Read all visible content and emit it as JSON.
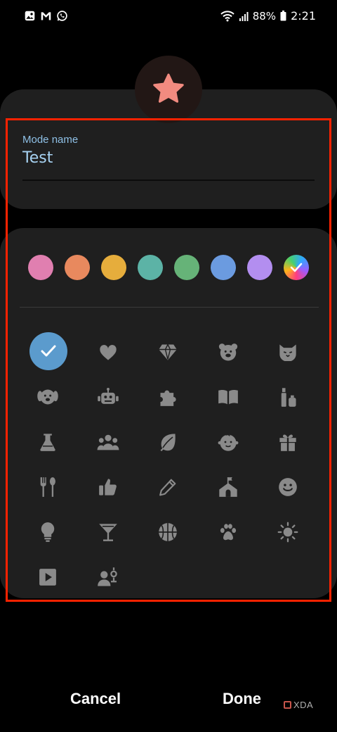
{
  "status_bar": {
    "time": "2:21",
    "battery_percent": "88%",
    "left_icons": [
      "gallery-icon",
      "gmail-icon",
      "whatsapp-icon"
    ],
    "right_icons": [
      "wifi-icon",
      "signal-icon",
      "battery-icon"
    ]
  },
  "mode": {
    "selected_icon": "star-icon",
    "icon_color": "#f28b80",
    "name_label": "Mode name",
    "name_value": "Test"
  },
  "colors": [
    {
      "name": "pink",
      "hex": "#e07fb0"
    },
    {
      "name": "orange",
      "hex": "#e8895e"
    },
    {
      "name": "yellow",
      "hex": "#e6ad3c"
    },
    {
      "name": "teal",
      "hex": "#5cb3a6"
    },
    {
      "name": "green",
      "hex": "#66b378"
    },
    {
      "name": "blue",
      "hex": "#6b9be0"
    },
    {
      "name": "purple",
      "hex": "#b38ef0"
    },
    {
      "name": "custom",
      "hex": "rainbow",
      "selected": true
    }
  ],
  "icons": [
    "selected-check-icon",
    "heart-icon",
    "diamond-icon",
    "bear-icon",
    "cat-icon",
    "dog-icon",
    "robot-icon",
    "puzzle-icon",
    "book-icon",
    "cosmetics-icon",
    "flask-icon",
    "people-icon",
    "leaf-icon",
    "baby-icon",
    "gift-icon",
    "fork-spoon-icon",
    "thumbs-up-icon",
    "pencil-icon",
    "house-icon",
    "smile-icon",
    "lightbulb-icon",
    "cocktail-icon",
    "basketball-icon",
    "paw-icon",
    "sun-icon",
    "play-icon",
    "person-settings-icon"
  ],
  "actions": {
    "cancel_label": "Cancel",
    "done_label": "Done"
  },
  "watermark": "XDA"
}
